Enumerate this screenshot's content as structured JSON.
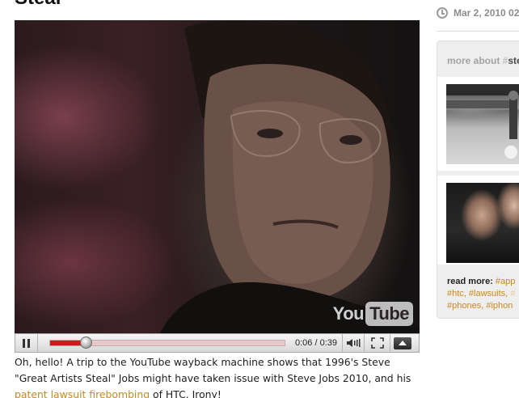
{
  "article": {
    "title": "Steal",
    "video": {
      "logo_you": "You",
      "logo_tube": "Tube",
      "time_current": "0:06",
      "time_separator": " / ",
      "time_total": "0:39",
      "progress_fraction": 0.154,
      "progress_color": "#cc1c1c"
    },
    "caption": {
      "text_1": "Oh, hello! A trip to the YouTube wayback machine shows that 1996's Steve \"Great Artists Steal\" Jobs might have taken issue with Steve Jobs 2010, and his ",
      "link": "patent lawsuit firebombing",
      "text_2": " of HTC. Irony!"
    }
  },
  "sidebar": {
    "date": "Mar 2, 2010 02",
    "more_about": {
      "label": "more about ",
      "hash": "#",
      "tag": "ste"
    },
    "read_more": {
      "label": "read more:",
      "line1_tags": [
        "#app"
      ],
      "line2_tags": [
        "#htc,",
        "#lawsuits,",
        "#"
      ],
      "line3_tags": [
        "#phones,",
        "#iphon"
      ]
    }
  },
  "colors": {
    "link": "#c8891f",
    "panel_bg": "#eeeeee",
    "meta_gray": "#8c8c8c"
  }
}
